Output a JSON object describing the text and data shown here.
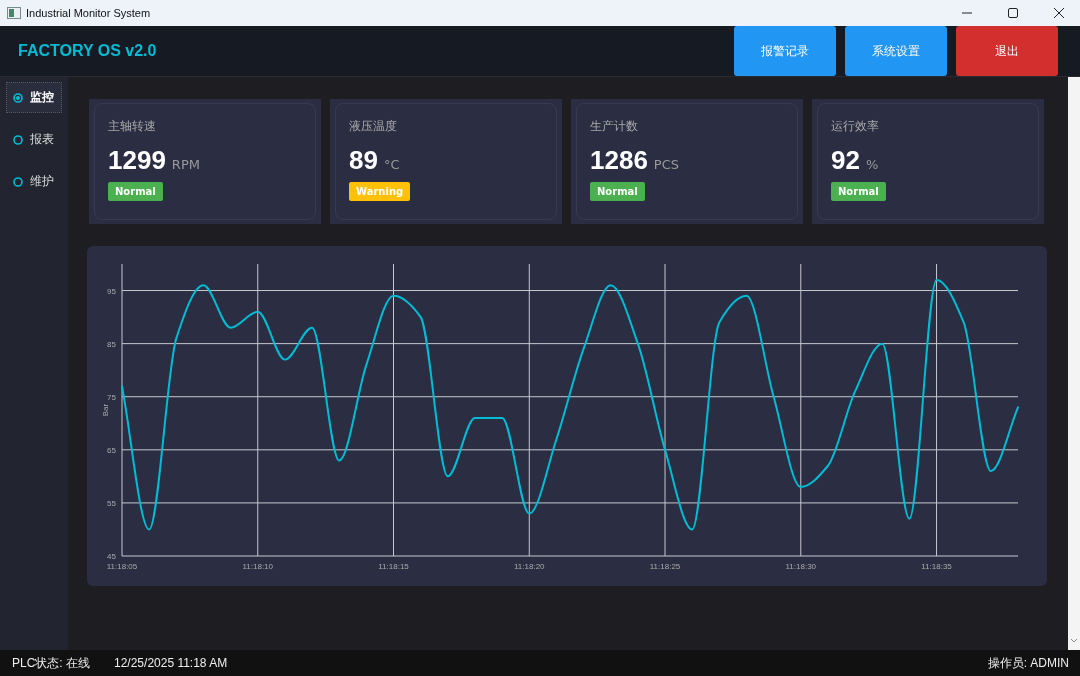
{
  "window": {
    "title": "Industrial Monitor System"
  },
  "header": {
    "title": "FACTORY OS v2.0",
    "buttons": [
      {
        "label": "报警记录",
        "kind": "primary"
      },
      {
        "label": "系统设置",
        "kind": "primary"
      },
      {
        "label": "退出",
        "kind": "danger"
      }
    ]
  },
  "sidebar": {
    "items": [
      {
        "label": "监控",
        "selected": true
      },
      {
        "label": "报表",
        "selected": false
      },
      {
        "label": "维护",
        "selected": false
      }
    ]
  },
  "cards": [
    {
      "label": "主轴转速",
      "value": "1299",
      "unit": "RPM",
      "status": {
        "label": "Normal",
        "kind": "normal"
      }
    },
    {
      "label": "液压温度",
      "value": "89",
      "unit": "°C",
      "status": {
        "label": "Warning",
        "kind": "warning"
      }
    },
    {
      "label": "生产计数",
      "value": "1286",
      "unit": "PCS",
      "status": {
        "label": "Normal",
        "kind": "normal"
      }
    },
    {
      "label": "运行效率",
      "value": "92",
      "unit": "%",
      "status": {
        "label": "Normal",
        "kind": "normal"
      }
    }
  ],
  "chart": {
    "chart_data": {
      "type": "line",
      "ylabel": "Bar",
      "categories": [
        "11:18:05",
        null,
        null,
        null,
        null,
        "11:18:10",
        null,
        null,
        null,
        null,
        "11:18:15",
        null,
        null,
        null,
        null,
        "11:18:20",
        null,
        null,
        null,
        null,
        "11:18:25",
        null,
        null,
        null,
        null,
        "11:18:30",
        null,
        null,
        null,
        null,
        "11:18:35",
        null,
        null,
        null
      ],
      "series": [
        {
          "color": "#00bcd4",
          "values": [
            77,
            50,
            86,
            96,
            88,
            91,
            82,
            88,
            63,
            81,
            94,
            90,
            60,
            71,
            71,
            53,
            67,
            84,
            96,
            85,
            65,
            50,
            89,
            94,
            75,
            58,
            62,
            76,
            85,
            52,
            97,
            89,
            61,
            73
          ]
        }
      ],
      "ylim": [
        45,
        100
      ],
      "grid": true,
      "yticks": [
        45,
        55,
        65,
        75,
        85,
        95
      ]
    }
  },
  "status_bar": {
    "plc": "PLC状态: 在线",
    "datetime": "12/25/2025 11:18 AM",
    "operator": "操作员: ADMIN"
  }
}
